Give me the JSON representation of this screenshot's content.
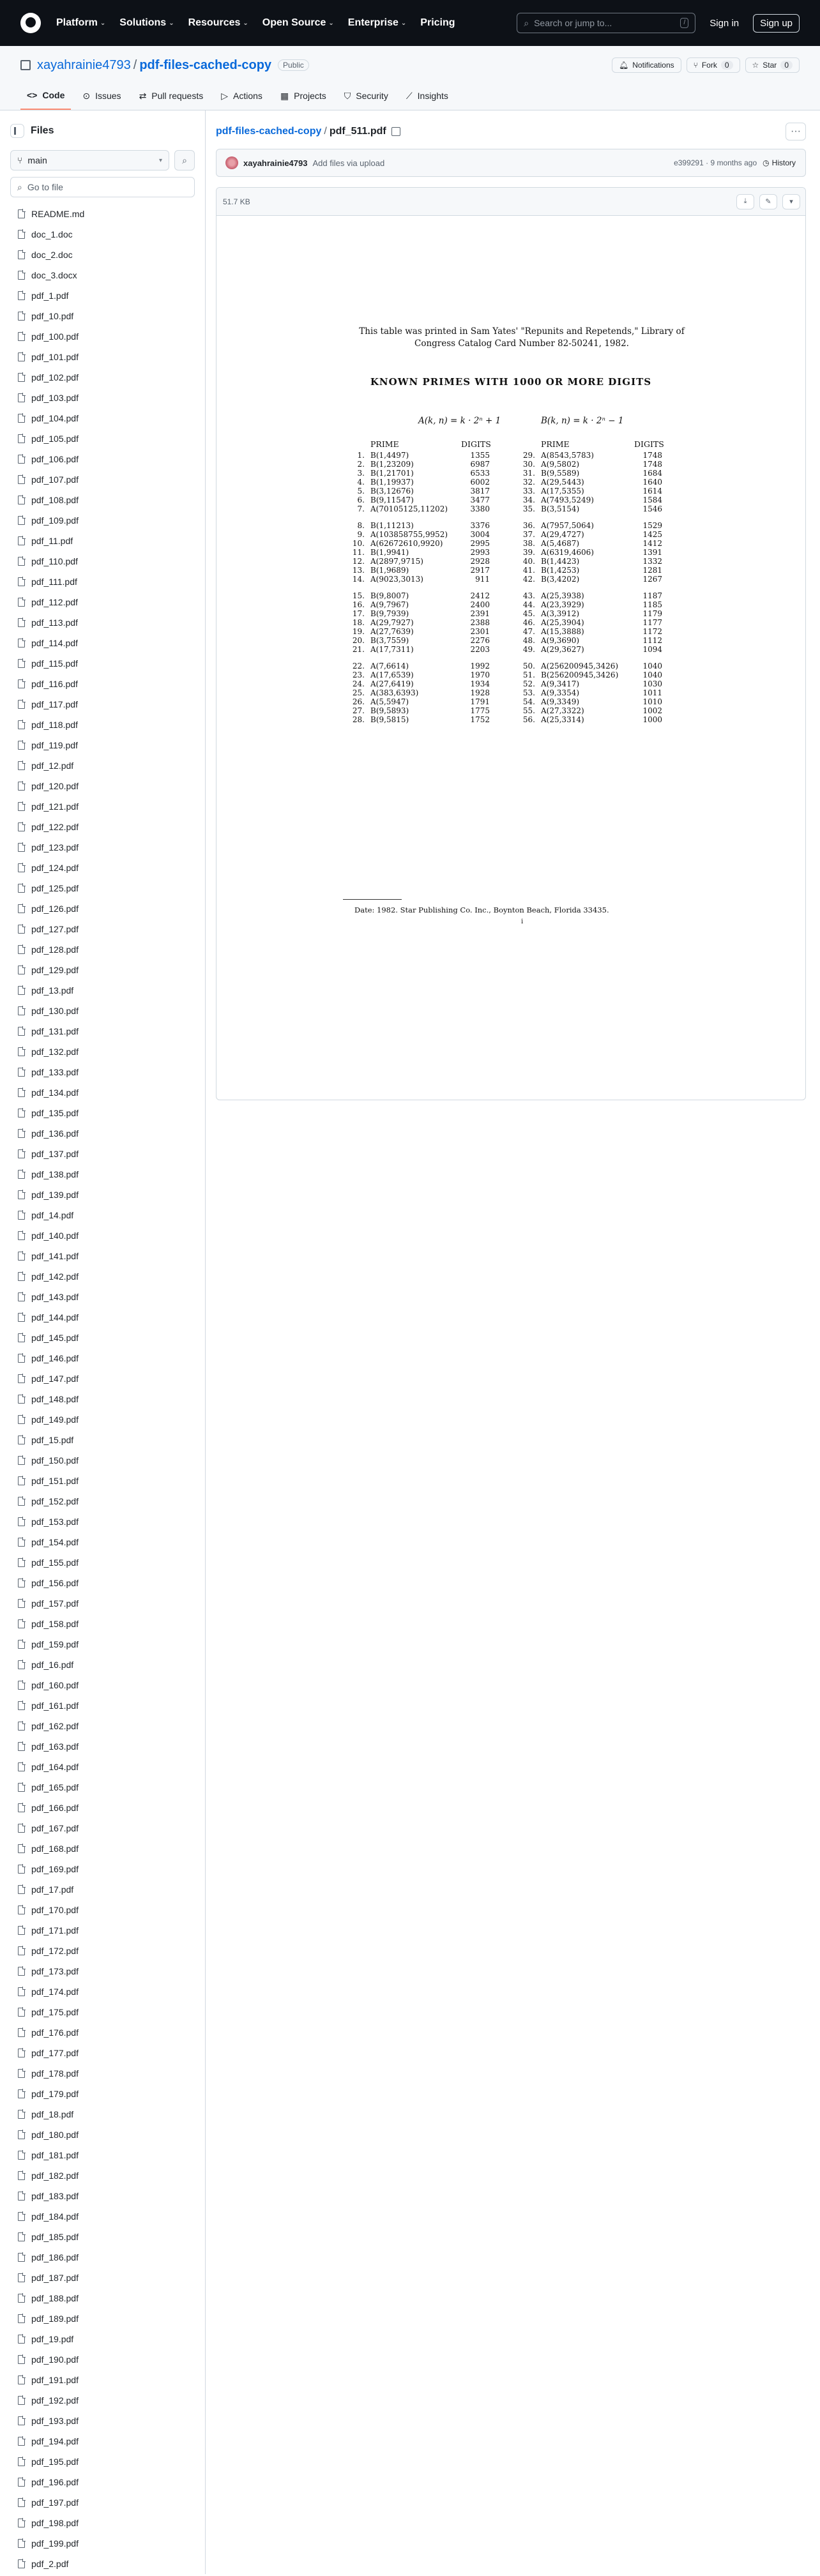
{
  "header": {
    "nav": [
      "Platform",
      "Solutions",
      "Resources",
      "Open Source",
      "Enterprise",
      "Pricing"
    ],
    "search_placeholder": "Search or jump to...",
    "search_key": "/",
    "signin": "Sign in",
    "signup": "Sign up"
  },
  "repo": {
    "owner": "xayahrainie4793",
    "name": "pdf-files-cached-copy",
    "visibility": "Public",
    "notifications": "Notifications",
    "fork": "Fork",
    "fork_count": "0",
    "star": "Star",
    "star_count": "0"
  },
  "tabs": [
    "Code",
    "Issues",
    "Pull requests",
    "Actions",
    "Projects",
    "Security",
    "Insights"
  ],
  "sidebar": {
    "title": "Files",
    "branch": "main",
    "goto_placeholder": "Go to file",
    "files": [
      "README.md",
      "doc_1.doc",
      "doc_2.doc",
      "doc_3.docx",
      "pdf_1.pdf",
      "pdf_10.pdf",
      "pdf_100.pdf",
      "pdf_101.pdf",
      "pdf_102.pdf",
      "pdf_103.pdf",
      "pdf_104.pdf",
      "pdf_105.pdf",
      "pdf_106.pdf",
      "pdf_107.pdf",
      "pdf_108.pdf",
      "pdf_109.pdf",
      "pdf_11.pdf",
      "pdf_110.pdf",
      "pdf_111.pdf",
      "pdf_112.pdf",
      "pdf_113.pdf",
      "pdf_114.pdf",
      "pdf_115.pdf",
      "pdf_116.pdf",
      "pdf_117.pdf",
      "pdf_118.pdf",
      "pdf_119.pdf",
      "pdf_12.pdf",
      "pdf_120.pdf",
      "pdf_121.pdf",
      "pdf_122.pdf",
      "pdf_123.pdf",
      "pdf_124.pdf",
      "pdf_125.pdf",
      "pdf_126.pdf",
      "pdf_127.pdf",
      "pdf_128.pdf",
      "pdf_129.pdf",
      "pdf_13.pdf",
      "pdf_130.pdf",
      "pdf_131.pdf",
      "pdf_132.pdf",
      "pdf_133.pdf",
      "pdf_134.pdf",
      "pdf_135.pdf",
      "pdf_136.pdf",
      "pdf_137.pdf",
      "pdf_138.pdf",
      "pdf_139.pdf",
      "pdf_14.pdf",
      "pdf_140.pdf",
      "pdf_141.pdf",
      "pdf_142.pdf",
      "pdf_143.pdf",
      "pdf_144.pdf",
      "pdf_145.pdf",
      "pdf_146.pdf",
      "pdf_147.pdf",
      "pdf_148.pdf",
      "pdf_149.pdf",
      "pdf_15.pdf",
      "pdf_150.pdf",
      "pdf_151.pdf",
      "pdf_152.pdf",
      "pdf_153.pdf",
      "pdf_154.pdf",
      "pdf_155.pdf",
      "pdf_156.pdf",
      "pdf_157.pdf",
      "pdf_158.pdf",
      "pdf_159.pdf",
      "pdf_16.pdf",
      "pdf_160.pdf",
      "pdf_161.pdf",
      "pdf_162.pdf",
      "pdf_163.pdf",
      "pdf_164.pdf",
      "pdf_165.pdf",
      "pdf_166.pdf",
      "pdf_167.pdf",
      "pdf_168.pdf",
      "pdf_169.pdf",
      "pdf_17.pdf",
      "pdf_170.pdf",
      "pdf_171.pdf",
      "pdf_172.pdf",
      "pdf_173.pdf",
      "pdf_174.pdf",
      "pdf_175.pdf",
      "pdf_176.pdf",
      "pdf_177.pdf",
      "pdf_178.pdf",
      "pdf_179.pdf",
      "pdf_18.pdf",
      "pdf_180.pdf",
      "pdf_181.pdf",
      "pdf_182.pdf",
      "pdf_183.pdf",
      "pdf_184.pdf",
      "pdf_185.pdf",
      "pdf_186.pdf",
      "pdf_187.pdf",
      "pdf_188.pdf",
      "pdf_189.pdf",
      "pdf_19.pdf",
      "pdf_190.pdf",
      "pdf_191.pdf",
      "pdf_192.pdf",
      "pdf_193.pdf",
      "pdf_194.pdf",
      "pdf_195.pdf",
      "pdf_196.pdf",
      "pdf_197.pdf",
      "pdf_198.pdf",
      "pdf_199.pdf",
      "pdf_2.pdf"
    ]
  },
  "file": {
    "path_repo": "pdf-files-cached-copy",
    "path_sep": "/",
    "name": "pdf_511.pdf",
    "size": "51.7 KB",
    "commit_user": "xayahrainie4793",
    "commit_msg": "Add files via upload",
    "commit_hash": "e399291 · 9 months ago",
    "history": "History"
  },
  "pdf": {
    "intro": "This table was printed in Sam Yates' \"Repunits and Repetends,\" Library of Congress Catalog Card Number 82-50241, 1982.",
    "title": "KNOWN PRIMES WITH 1000 OR MORE DIGITS",
    "left_head": "A(k, n) = k · 2ⁿ + 1",
    "right_head": "B(k, n) = k · 2ⁿ − 1",
    "col_prime": "PRIME",
    "col_digits": "DIGITS",
    "left_rows": [
      [
        "1.",
        "B(1,4497)",
        "1355"
      ],
      [
        "2.",
        "B(1,23209)",
        "6987"
      ],
      [
        "3.",
        "B(1,21701)",
        "6533"
      ],
      [
        "4.",
        "B(1,19937)",
        "6002"
      ],
      [
        "5.",
        "B(3,12676)",
        "3817"
      ],
      [
        "6.",
        "B(9,11547)",
        "3477"
      ],
      [
        "7.",
        "A(70105125,11202)",
        "3380"
      ],
      [
        "8.",
        "B(1,11213)",
        "3376"
      ],
      [
        "9.",
        "A(103858755,9952)",
        "3004"
      ],
      [
        "10.",
        "A(62672610,9920)",
        "2995"
      ],
      [
        "11.",
        "B(1,9941)",
        "2993"
      ],
      [
        "12.",
        "A(2897,9715)",
        "2928"
      ],
      [
        "13.",
        "B(1,9689)",
        "2917"
      ],
      [
        "14.",
        "A(9023,3013)",
        "911"
      ],
      [
        "15.",
        "B(9,8007)",
        "2412"
      ],
      [
        "16.",
        "A(9,7967)",
        "2400"
      ],
      [
        "17.",
        "B(9,7939)",
        "2391"
      ],
      [
        "18.",
        "A(29,7927)",
        "2388"
      ],
      [
        "19.",
        "A(27,7639)",
        "2301"
      ],
      [
        "20.",
        "B(3,7559)",
        "2276"
      ],
      [
        "21.",
        "A(17,7311)",
        "2203"
      ],
      [
        "22.",
        "A(7,6614)",
        "1992"
      ],
      [
        "23.",
        "A(17,6539)",
        "1970"
      ],
      [
        "24.",
        "A(27,6419)",
        "1934"
      ],
      [
        "25.",
        "A(383,6393)",
        "1928"
      ],
      [
        "26.",
        "A(5,5947)",
        "1791"
      ],
      [
        "27.",
        "B(9,5893)",
        "1775"
      ],
      [
        "28.",
        "B(9,5815)",
        "1752"
      ]
    ],
    "right_rows": [
      [
        "29.",
        "A(8543,5783)",
        "1748"
      ],
      [
        "30.",
        "A(9,5802)",
        "1748"
      ],
      [
        "31.",
        "B(9,5589)",
        "1684"
      ],
      [
        "32.",
        "A(29,5443)",
        "1640"
      ],
      [
        "33.",
        "A(17,5355)",
        "1614"
      ],
      [
        "34.",
        "A(7493,5249)",
        "1584"
      ],
      [
        "35.",
        "B(3,5154)",
        "1546"
      ],
      [
        "36.",
        "A(7957,5064)",
        "1529"
      ],
      [
        "37.",
        "A(29,4727)",
        "1425"
      ],
      [
        "38.",
        "A(5,4687)",
        "1412"
      ],
      [
        "39.",
        "A(6319,4606)",
        "1391"
      ],
      [
        "40.",
        "B(1,4423)",
        "1332"
      ],
      [
        "41.",
        "B(1,4253)",
        "1281"
      ],
      [
        "42.",
        "B(3,4202)",
        "1267"
      ],
      [
        "43.",
        "A(25,3938)",
        "1187"
      ],
      [
        "44.",
        "A(23,3929)",
        "1185"
      ],
      [
        "45.",
        "A(3,3912)",
        "1179"
      ],
      [
        "46.",
        "A(25,3904)",
        "1177"
      ],
      [
        "47.",
        "A(15,3888)",
        "1172"
      ],
      [
        "48.",
        "A(9,3690)",
        "1112"
      ],
      [
        "49.",
        "A(29,3627)",
        "1094"
      ],
      [
        "50.",
        "A(256200945,3426)",
        "1040"
      ],
      [
        "51.",
        "B(256200945,3426)",
        "1040"
      ],
      [
        "52.",
        "A(9,3417)",
        "1030"
      ],
      [
        "53.",
        "A(9,3354)",
        "1011"
      ],
      [
        "54.",
        "A(9,3349)",
        "1010"
      ],
      [
        "55.",
        "A(27,3322)",
        "1002"
      ],
      [
        "56.",
        "A(25,3314)",
        "1000"
      ]
    ],
    "footnote": "Date: 1982. Star Publishing Co. Inc., Boynton Beach, Florida 33435.",
    "page_number": "i"
  }
}
